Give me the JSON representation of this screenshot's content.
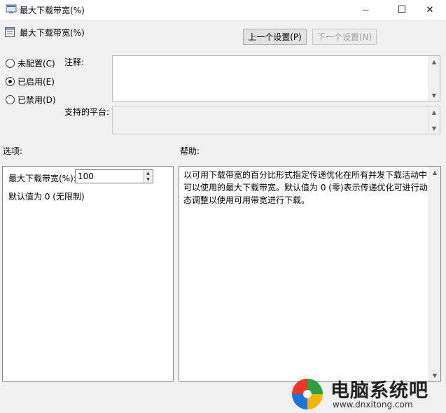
{
  "window": {
    "title": "最大下载带宽(%)",
    "minimize_glyph": "—",
    "maximize_glyph": "☐",
    "close_glyph": "✕"
  },
  "header": {
    "policy_title": "最大下载带宽(%)",
    "prev_button": "上一个设置(P)",
    "next_button": "下一个设置(N)"
  },
  "state": {
    "options": [
      {
        "label": "未配置(C)",
        "checked": false
      },
      {
        "label": "已启用(E)",
        "checked": true
      },
      {
        "label": "已禁用(D)",
        "checked": false
      }
    ]
  },
  "comment": {
    "label": "注释:",
    "value": ""
  },
  "platform": {
    "label": "支持的平台:",
    "value": ""
  },
  "options_section": {
    "heading": "选项:",
    "field_label": "最大下载带宽(%):",
    "field_value": "100",
    "default_note": "默认值为 0 (无限制)"
  },
  "help_section": {
    "heading": "帮助:",
    "text": "以可用下载带宽的百分比形式指定传递优化在所有并发下载活动中可以使用的最大下载带宽。默认值为 0 (零)表示传递优化可进行动态调整以使用可用带宽进行下载。"
  },
  "watermark": {
    "name": "电脑系统吧",
    "url": "www.dnxitong.com"
  },
  "icons": {
    "app": "policy-editor-icon",
    "policy": "policy-setting-icon",
    "scroll_up": "scroll-up-arrow-icon",
    "scroll_down": "scroll-down-arrow-icon"
  }
}
